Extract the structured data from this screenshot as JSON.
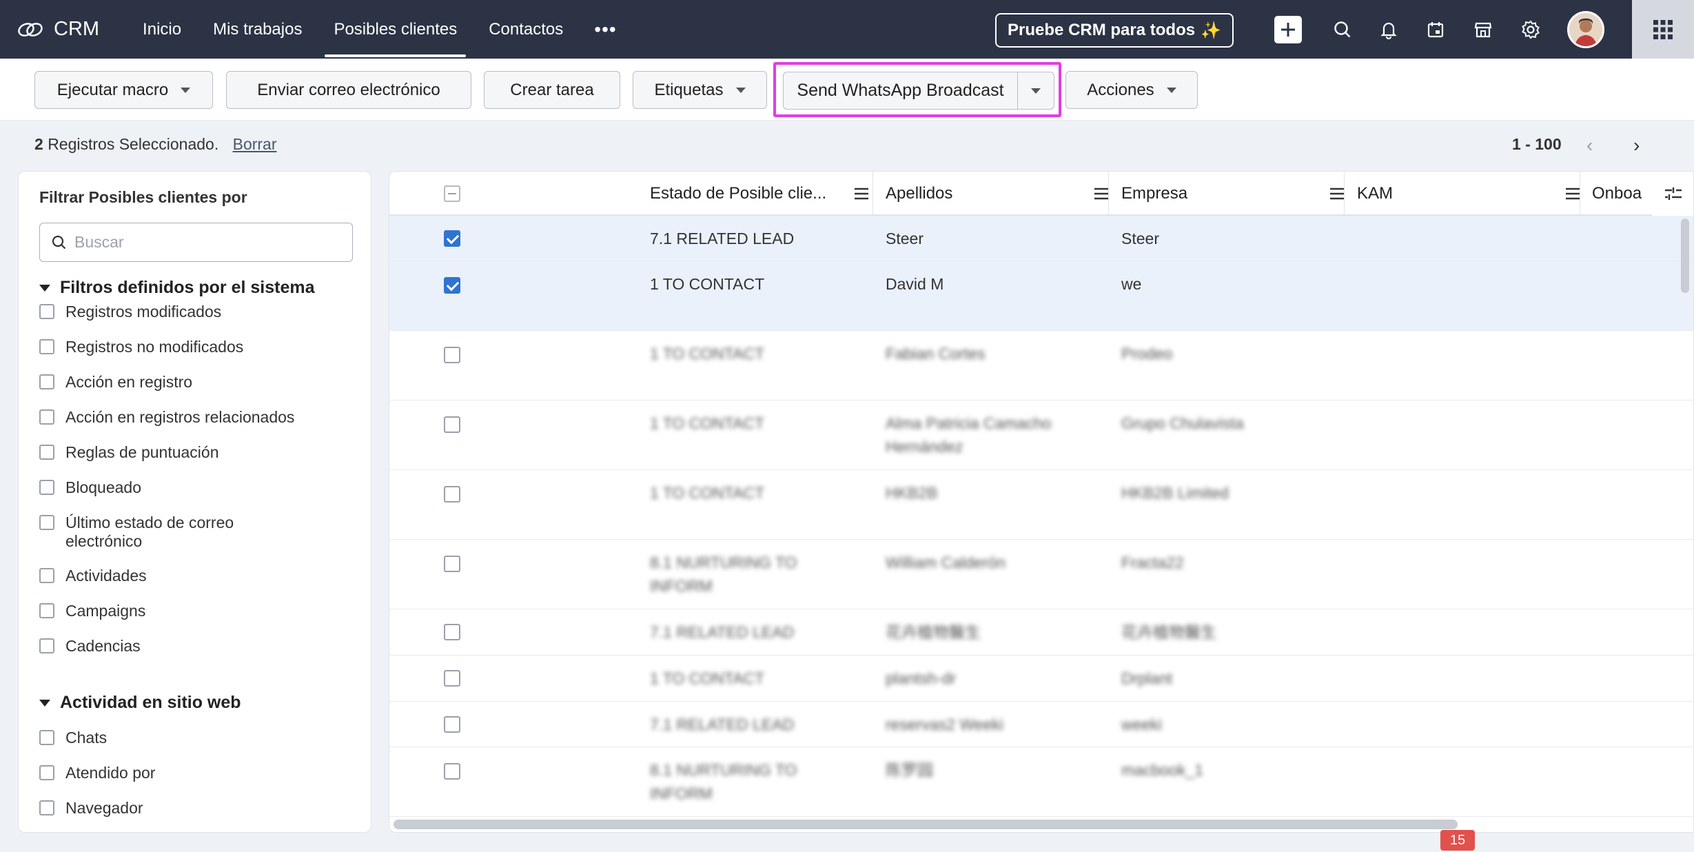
{
  "app": {
    "name": "CRM"
  },
  "nav": {
    "tabs": [
      {
        "label": "Inicio"
      },
      {
        "label": "Mis trabajos"
      },
      {
        "label": "Posibles clientes"
      },
      {
        "label": "Contactos"
      }
    ],
    "more": "•••",
    "try_button": "Pruebe CRM para todos",
    "try_sparkle": "✨"
  },
  "toolbar": {
    "macro": "Ejecutar macro",
    "email": "Enviar correo electrónico",
    "task": "Crear tarea",
    "tags": "Etiquetas",
    "whatsapp": "Send WhatsApp Broadcast",
    "actions": "Acciones"
  },
  "selection": {
    "count": "2",
    "text": "Registros Seleccionado.",
    "clear": "Borrar"
  },
  "pager": {
    "range": "1 - 100"
  },
  "filters": {
    "title": "Filtrar Posibles clientes por",
    "search_placeholder": "Buscar",
    "system_section": "Filtros definidos por el sistema",
    "system_items": [
      "Registros modificados",
      "Registros no modificados",
      "Acción en registro",
      "Acción en registros relacionados",
      "Reglas de puntuación",
      "Bloqueado",
      "Último estado de correo",
      "electrónico",
      "Actividades",
      "Campaigns",
      "Cadencias"
    ],
    "web_section": "Actividad en sitio web",
    "web_items": [
      "Chats",
      "Atendido por",
      "Navegador"
    ]
  },
  "grid": {
    "columns": [
      "Estado de Posible clie...",
      "Apellidos",
      "Empresa",
      "KAM",
      "Onboa"
    ],
    "rows": [
      {
        "status": "7.1 RELATED LEAD",
        "status2": "",
        "surname": "Steer",
        "surname2": "",
        "company": "Steer",
        "selected": true
      },
      {
        "status": "1 TO CONTACT",
        "status2": "",
        "surname": "David M",
        "surname2": "",
        "company": "we",
        "selected": true
      },
      {
        "status": "1 TO CONTACT",
        "status2": "",
        "surname": "Fabian Cortes",
        "surname2": "",
        "company": "Prodeo",
        "selected": false
      },
      {
        "status": "1 TO CONTACT",
        "status2": "",
        "surname": "Alma Patricia Camacho",
        "surname2": "Hernández",
        "company": "Grupo Chulavista",
        "selected": false
      },
      {
        "status": "1 TO CONTACT",
        "status2": "",
        "surname": "HKB2B",
        "surname2": "",
        "company": "HKB2B Limited",
        "selected": false
      },
      {
        "status": "8.1 NURTURING TO",
        "status2": "INFORM",
        "surname": "William Calderón",
        "surname2": "",
        "company": "Fracta22",
        "selected": false
      },
      {
        "status": "7.1 RELATED LEAD",
        "status2": "",
        "surname": "花卉植物醫生",
        "surname2": "",
        "company": "花卉植物醫生",
        "selected": false
      },
      {
        "status": "1 TO CONTACT",
        "status2": "",
        "surname": "plantsh-dr",
        "surname2": "",
        "company": "Drplant",
        "selected": false
      },
      {
        "status": "7.1 RELATED LEAD",
        "status2": "",
        "surname": "reservas2 Weeki",
        "surname2": "",
        "company": "weeki",
        "selected": false
      },
      {
        "status": "8.1 NURTURING TO",
        "status2": "INFORM",
        "surname": "陈罗园",
        "surname2": "",
        "company": "macbook_1",
        "selected": false
      }
    ]
  },
  "notification_badge": "15",
  "colors": {
    "topbar": "#2b3345",
    "highlight": "#e23ce5",
    "checkbox": "#2f74d0",
    "badge": "#e2514b"
  }
}
